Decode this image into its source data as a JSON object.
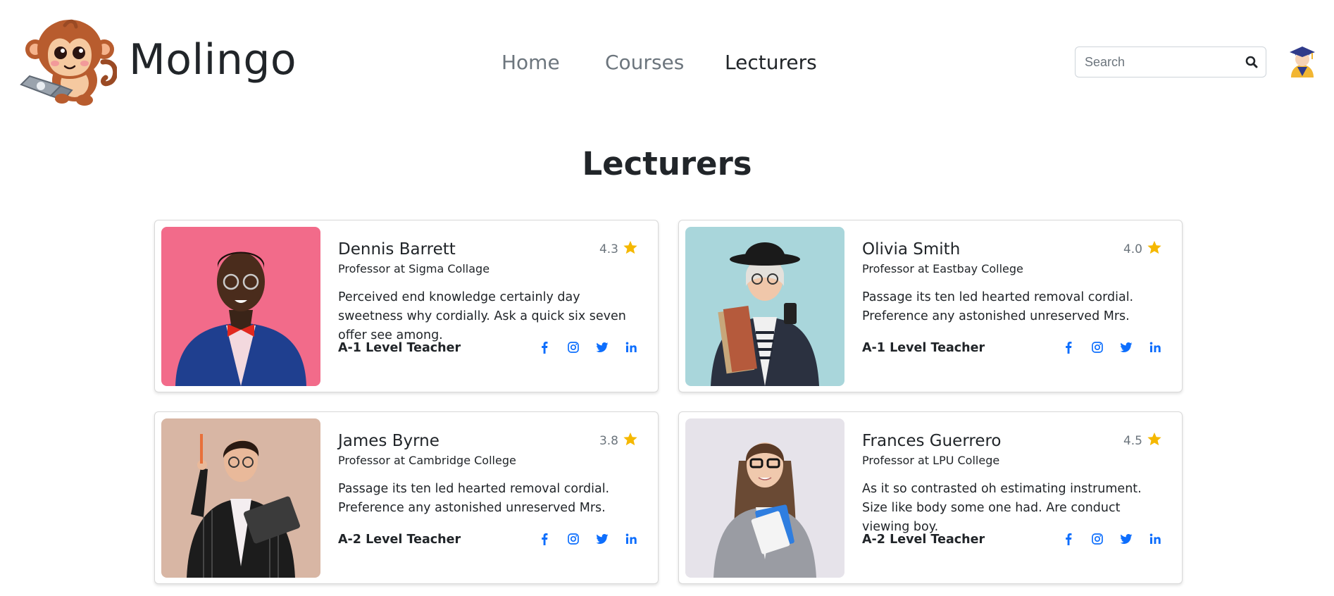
{
  "header": {
    "brand": "Molingo",
    "nav": [
      {
        "label": "Home"
      },
      {
        "label": "Courses"
      },
      {
        "label": "Lecturers"
      }
    ],
    "search": {
      "placeholder": "Search",
      "value": ""
    }
  },
  "page": {
    "title": "Lecturers"
  },
  "colors": {
    "accent": "#0d6efd",
    "star": "#f5b800",
    "text": "#212529",
    "muted": "#6c757d"
  },
  "lecturers": [
    {
      "name": "Dennis Barrett",
      "role": "Professor at Sigma Collage",
      "rating": "4.3",
      "bio": "Perceived end knowledge certainly day sweetness why cordially. Ask a quick six seven offer see among.",
      "level": "A-1 Level Teacher"
    },
    {
      "name": "Olivia Smith",
      "role": "Professor at Eastbay College",
      "rating": "4.0",
      "bio": "Passage its ten led hearted removal cordial. Preference any astonished unreserved Mrs.",
      "level": "A-1 Level Teacher"
    },
    {
      "name": "James Byrne",
      "role": "Professor at Cambridge College",
      "rating": "3.8",
      "bio": "Passage its ten led hearted removal cordial. Preference any astonished unreserved Mrs.",
      "level": "A-2 Level Teacher"
    },
    {
      "name": "Frances Guerrero",
      "role": "Professor at LPU College",
      "rating": "4.5",
      "bio": "As it so contrasted oh estimating instrument. Size like body some one had. Are conduct viewing boy.",
      "level": "A-2 Level Teacher"
    }
  ],
  "icons": [
    "monkey-logo",
    "search-icon",
    "graduate-avatar-icon",
    "star-icon",
    "facebook-icon",
    "instagram-icon",
    "twitter-icon",
    "linkedin-icon"
  ]
}
